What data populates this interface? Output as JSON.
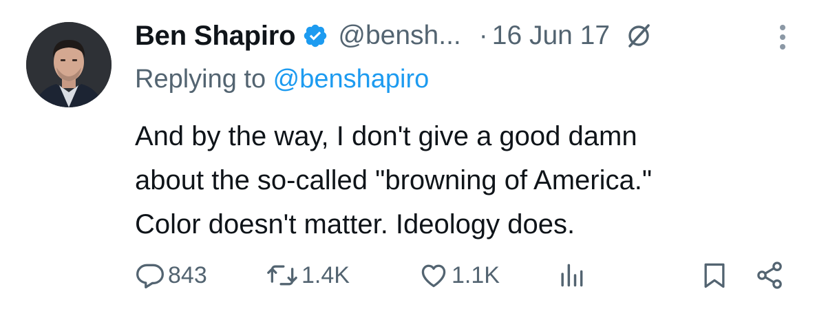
{
  "author": {
    "display_name": "Ben Shapiro",
    "handle": "@bensh...",
    "verified": true,
    "verified_color": "#1d9bf0"
  },
  "meta": {
    "separator": "·",
    "date": "16 Jun 17"
  },
  "reply": {
    "prefix": "Replying to ",
    "mention": "@benshapiro"
  },
  "body": {
    "lines": [
      "And by the way, I don't give a good damn",
      "about the so-called \"browning of America.\"",
      "Color doesn't matter. Ideology does."
    ]
  },
  "actions": {
    "replies": "843",
    "reposts": "1.4K",
    "likes": "1.1K"
  },
  "icons": {
    "reply": "speech-bubble-icon",
    "repost": "repost-arrows-icon",
    "like": "heart-icon",
    "views": "bar-chart-icon",
    "bookmark": "bookmark-icon",
    "share": "share-nodes-icon",
    "grok": "grok-slash-circle-icon",
    "more": "vertical-dots-icon"
  },
  "colors": {
    "text": "#0f1419",
    "secondary": "#536471",
    "link": "#1d9bf0"
  }
}
